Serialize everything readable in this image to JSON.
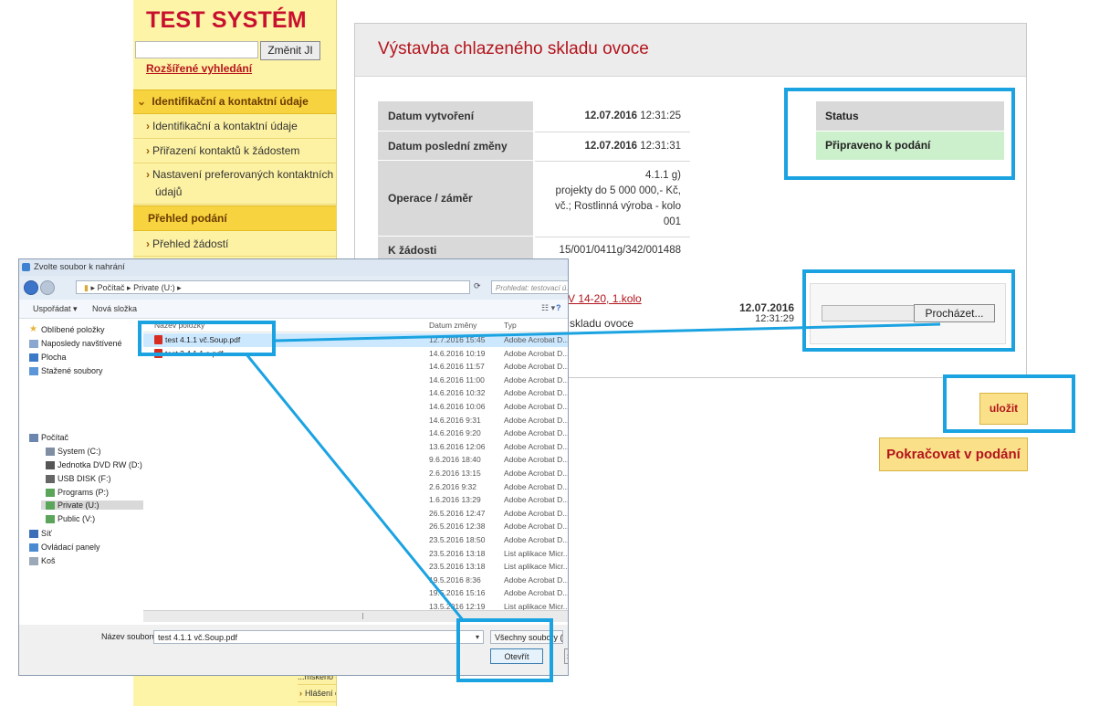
{
  "sidebar": {
    "title": "TEST SYSTÉM",
    "change_button": "Změnit JI",
    "advanced_search": "Rozšířené vyhledání",
    "section_contact": "Identifikační a kontaktní údaje",
    "items_contact": [
      "Identifikační a kontaktní údaje",
      "Přiřazení kontaktů k žádostem",
      "Nastavení preferovaných kontaktních",
      "údajů"
    ],
    "section_submission": "Přehled podání",
    "items_submission": [
      "Přehled žádostí"
    ],
    "bottom_items": [
      "Hlášení o přímém prodeji"
    ],
    "bottom_partial": "...mského o místa"
  },
  "main": {
    "title": "Výstavba chlazeného skladu ovoce",
    "info": [
      {
        "label": "Datum vytvoření",
        "date": "12.07.2016",
        "time": "12:31:25"
      },
      {
        "label": "Datum poslední změny",
        "date": "12.07.2016",
        "time": "12:31:31"
      },
      {
        "label": "Operace / záměr",
        "value_lines": [
          "4.1.1 g)",
          "projekty do 5 000 000,- Kč,",
          "vč.; Rostlinná výroba - kolo",
          "001"
        ]
      },
      {
        "label": "K žádosti",
        "value": "15/001/0411g/342/001488"
      }
    ],
    "status_label": "Status",
    "status_value": "Připraveno k podání",
    "upload": {
      "link_fragment": "V 14-20, 1.kolo",
      "desc_fragment": "skladu ovoce",
      "date": "12.07.2016",
      "time": "12:31:29",
      "browse_button": "Procházet..."
    },
    "save_button": "uložit",
    "continue_button": "Pokračovat v podání"
  },
  "dialog": {
    "title": "Zvolte soubor k nahrání",
    "path": [
      "Počítač",
      "Private (U:)"
    ],
    "search_placeholder": "Prohledat: testovací ú...",
    "organize": "Uspořádat",
    "new_folder": "Nová složka",
    "tree": {
      "favorites": "Oblíbené položky",
      "recent": "Naposledy navštívené",
      "desktop": "Plocha",
      "downloads": "Stažené soubory",
      "computer": "Počítač",
      "drives": [
        "System (C:)",
        "Jednotka DVD RW (D:)",
        "USB DISK (F:)",
        "Programs (P:)",
        "Private (U:)",
        "Public (V:)"
      ],
      "network": "Síť",
      "control_panel": "Ovládací panely",
      "recycle": "Koš"
    },
    "columns": {
      "name": "Název položky",
      "date": "Datum změny",
      "type": "Typ"
    },
    "files": [
      {
        "name": "test 4.1.1 vč.Soup.pdf",
        "date": "12.7.2016 15:45",
        "type": "Adobe Acrobat D..."
      },
      {
        "name": "test 2 4.1.1 a.pdf",
        "date": "14.6.2016 10:19",
        "type": "Adobe Acrobat D..."
      },
      {
        "name": "",
        "date": "14.6.2016 11:57",
        "type": "Adobe Acrobat D..."
      },
      {
        "name": "",
        "date": "14.6.2016 11:00",
        "type": "Adobe Acrobat D..."
      },
      {
        "name": "",
        "date": "14.6.2016 10:32",
        "type": "Adobe Acrobat D..."
      },
      {
        "name": "",
        "date": "14.6.2016 10:06",
        "type": "Adobe Acrobat D..."
      },
      {
        "name": "",
        "date": "14.6.2016 9:31",
        "type": "Adobe Acrobat D..."
      },
      {
        "name": "",
        "date": "14.6.2016 9:20",
        "type": "Adobe Acrobat D..."
      },
      {
        "name": "",
        "date": "13.6.2016 12:06",
        "type": "Adobe Acrobat D..."
      },
      {
        "name": "",
        "date": "9.6.2016 18:40",
        "type": "Adobe Acrobat D..."
      },
      {
        "name": "",
        "date": "2.6.2016 13:15",
        "type": "Adobe Acrobat D..."
      },
      {
        "name": "",
        "date": "2.6.2016 9:32",
        "type": "Adobe Acrobat D..."
      },
      {
        "name": "",
        "date": "1.6.2016 13:29",
        "type": "Adobe Acrobat D..."
      },
      {
        "name": "",
        "date": "26.5.2016 12:47",
        "type": "Adobe Acrobat D..."
      },
      {
        "name": "",
        "date": "26.5.2016 12:38",
        "type": "Adobe Acrobat D..."
      },
      {
        "name": "",
        "date": "23.5.2016 18:50",
        "type": "Adobe Acrobat D..."
      },
      {
        "name": "",
        "date": "23.5.2016 13:18",
        "type": "List aplikace Micr..."
      },
      {
        "name": "",
        "date": "23.5.2016 13:18",
        "type": "List aplikace Micr..."
      },
      {
        "name": "",
        "date": "19.5.2016 8:36",
        "type": "Adobe Acrobat D..."
      },
      {
        "name": "",
        "date": "19.5.2016 15:16",
        "type": "Adobe Acrobat D..."
      },
      {
        "name": "",
        "date": "13.5.2016 12:19",
        "type": "List aplikace Micr..."
      }
    ],
    "filename_label": "Název souboru:",
    "filename_value": "test 4.1.1 vč.Soup.pdf",
    "filetype": "Všechny soubory (*.*)",
    "open_button": "Otevřít",
    "cancel_fragment": "S"
  },
  "colors": {
    "accent": "#c8102e",
    "sidebar": "#fdf4a8",
    "section": "#f6d33f",
    "status_ok": "#ccf0cc",
    "annotation": "#1ba3e1"
  }
}
